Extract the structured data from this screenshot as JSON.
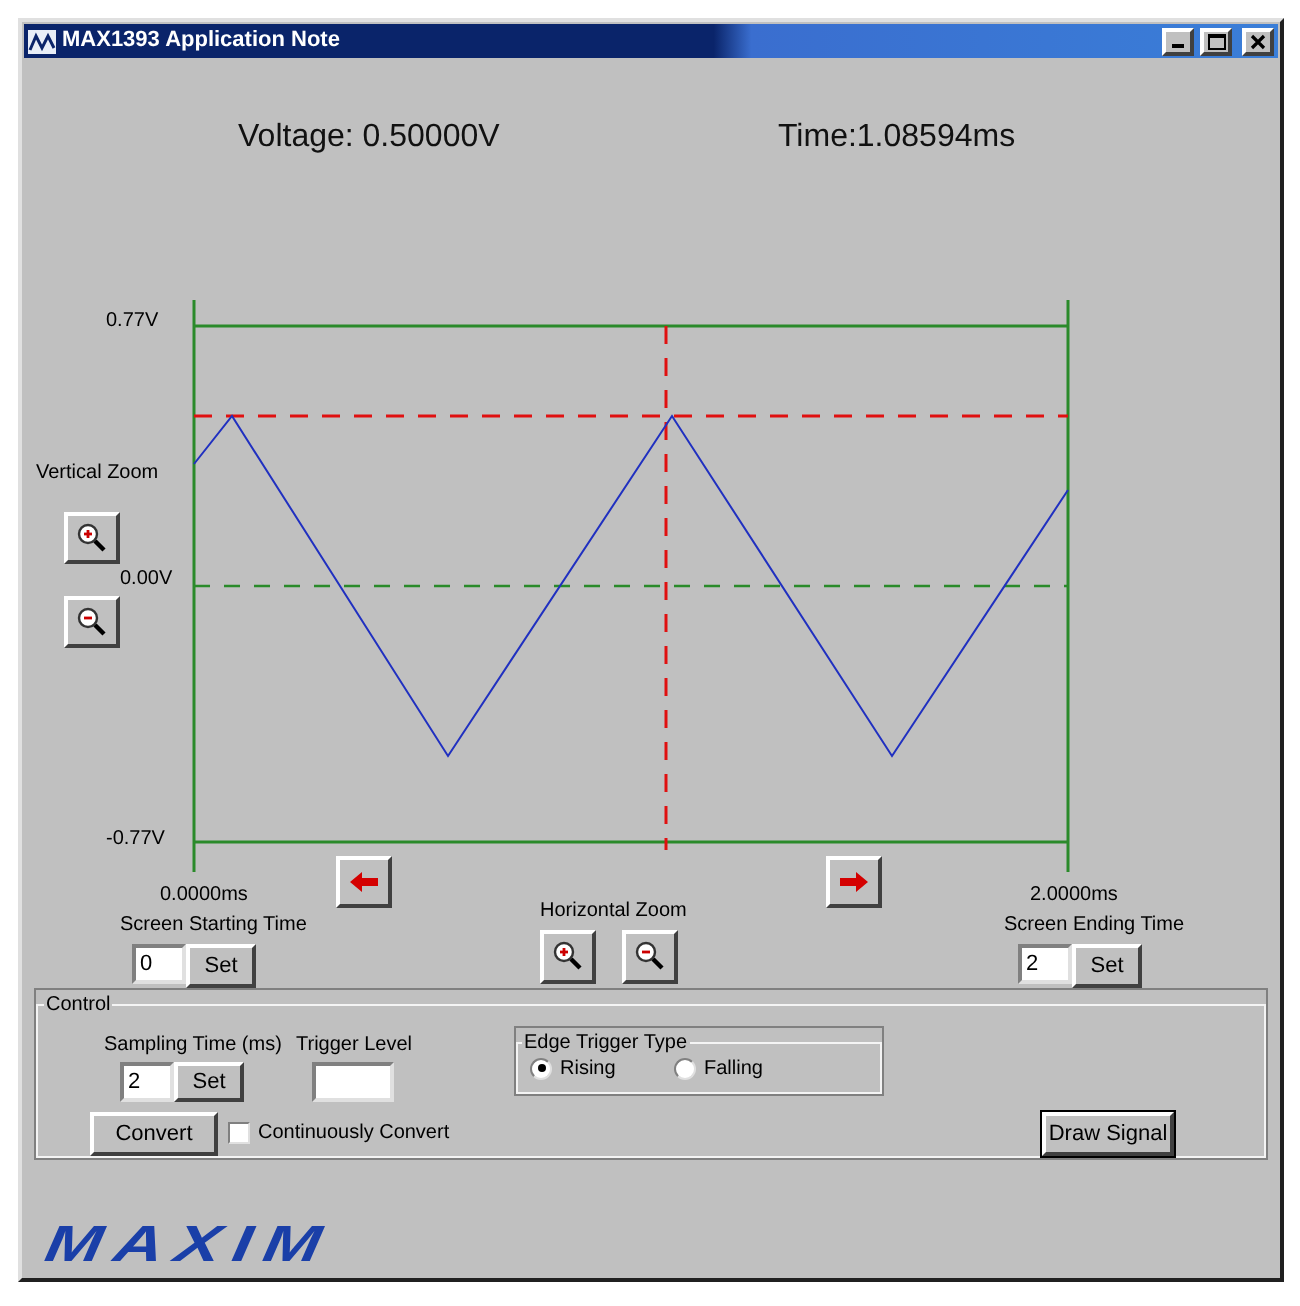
{
  "window": {
    "title": "MAX1393 Application Note"
  },
  "readouts": {
    "voltage": "Voltage: 0.50000V",
    "time": "Time:1.08594ms"
  },
  "plot": {
    "y_top": "0.77V",
    "y_mid": "0.00V",
    "y_bottom": "-0.77V",
    "x_start": "0.0000ms",
    "x_end": "2.0000ms",
    "vertical_zoom_label": "Vertical Zoom"
  },
  "screen_start": {
    "label": "Screen Starting Time",
    "value": "0",
    "button": "Set"
  },
  "horizontal_zoom": {
    "label": "Horizontal Zoom"
  },
  "screen_end": {
    "label": "Screen Ending Time",
    "value": "2",
    "button": "Set"
  },
  "control": {
    "legend": "Control",
    "sampling": {
      "label": "Sampling Time (ms)",
      "value": "2",
      "button": "Set"
    },
    "trigger_level": {
      "label": "Trigger Level"
    },
    "edge_trigger": {
      "legend": "Edge Trigger Type",
      "options": [
        {
          "label": "Rising",
          "selected": true
        },
        {
          "label": "Falling",
          "selected": false
        }
      ]
    },
    "convert_button": "Convert",
    "continuous": {
      "label": "Continuously Convert",
      "checked": false
    },
    "draw_button": "Draw Signal"
  },
  "logo": "MAXIM"
}
